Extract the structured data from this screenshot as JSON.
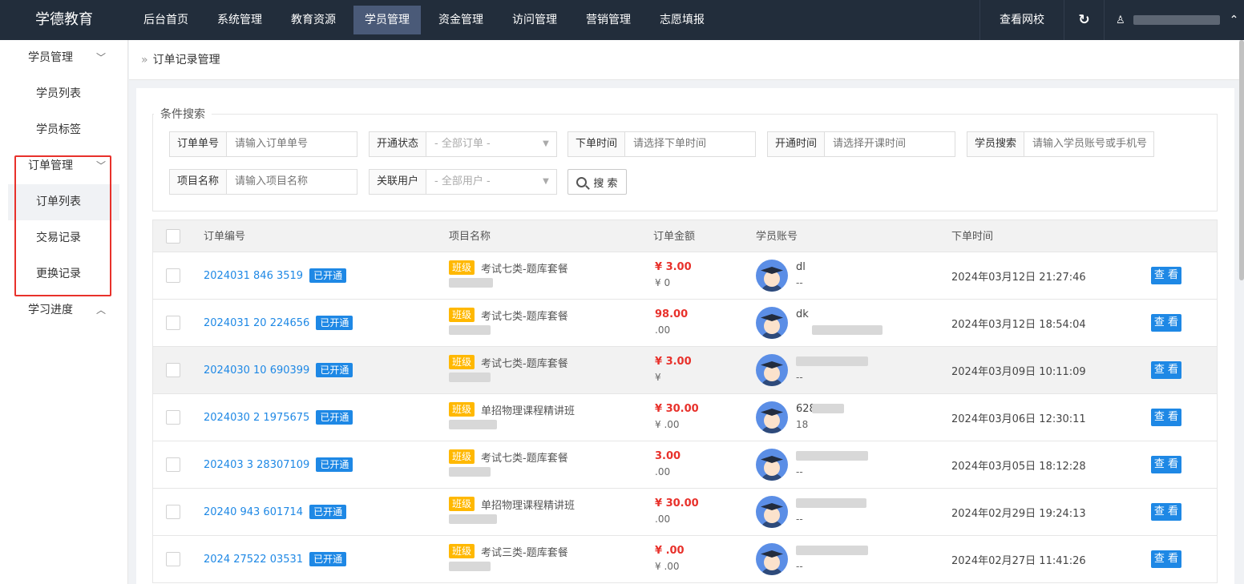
{
  "header": {
    "logo": "学德教育",
    "nav": [
      "后台首页",
      "系统管理",
      "教育资源",
      "学员管理",
      "资金管理",
      "访问管理",
      "营销管理",
      "志愿填报"
    ],
    "active_nav": "学员管理",
    "view_site": "查看网校",
    "refresh_icon": "↻",
    "user_icon": "♙",
    "caret": "⌃"
  },
  "sidebar": {
    "groups": [
      {
        "label": "学员管理",
        "chev": "﹀",
        "items": [
          "学员列表",
          "学员标签"
        ]
      },
      {
        "label": "订单管理",
        "chev": "﹀",
        "items": [
          "订单列表",
          "交易记录",
          "更换记录"
        ]
      },
      {
        "label": "学习进度",
        "chev": "︿",
        "items": []
      }
    ],
    "active_item": "订单列表"
  },
  "breadcrumb": {
    "sep": "»",
    "title": "订单记录管理"
  },
  "search": {
    "legend": "条件搜索",
    "order_no": {
      "label": "订单单号",
      "placeholder": "请输入订单单号"
    },
    "status": {
      "label": "开通状态",
      "value": "- 全部订单 -"
    },
    "order_time": {
      "label": "下单时间",
      "placeholder": "请选择下单时间"
    },
    "open_time": {
      "label": "开通时间",
      "placeholder": "请选择开课时间"
    },
    "student": {
      "label": "学员搜索",
      "placeholder": "请输入学员账号或手机号"
    },
    "project": {
      "label": "项目名称",
      "placeholder": "请输入项目名称"
    },
    "related_user": {
      "label": "关联用户",
      "value": "- 全部用户 -"
    },
    "search_button": "搜 索"
  },
  "table": {
    "headers": {
      "order_no": "订单编号",
      "project": "项目名称",
      "amount": "订单金额",
      "account": "学员账号",
      "time": "下单时间"
    },
    "status_label": "已开通",
    "tag_label": "班级",
    "view_label": "查 看",
    "rows": [
      {
        "order_no": "2024031  846  3519",
        "project": "考试七类-题库套餐",
        "price": "¥  3.00",
        "orig": "¥     0",
        "acc1": "dl",
        "acc2": "--",
        "time": "2024年03月12日 21:27:46"
      },
      {
        "order_no": "2024031  20  224656",
        "project": "考试七类-题库套餐",
        "price": " 98.00",
        "orig": "   .00",
        "acc1": "dk",
        "acc2": "",
        "time": "2024年03月12日 18:54:04"
      },
      {
        "order_no": "2024030  10  690399",
        "project": "考试七类-题库套餐",
        "price": "¥  3.00",
        "orig": "¥",
        "acc1": "",
        "acc2": "--",
        "time": "2024年03月09日 10:11:09"
      },
      {
        "order_no": "2024030  2 1975675",
        "project": "单招物理课程精讲班",
        "price": "¥  30.00",
        "orig": "¥ .00",
        "acc1": "  62809",
        "acc2": "18",
        "time": "2024年03月06日 12:30:11"
      },
      {
        "order_no": "202403  3 28307109",
        "project": "考试七类-题库套餐",
        "price": "  3.00",
        "orig": "  .00",
        "acc1": "",
        "acc2": "--",
        "time": "2024年03月05日 18:12:28"
      },
      {
        "order_no": "20240  943  601714",
        "project": "单招物理课程精讲班",
        "price": "¥  30.00",
        "orig": "  .00",
        "acc1": "",
        "acc2": "--",
        "time": "2024年02月29日 19:24:13"
      },
      {
        "order_no": "2024 27522  03531",
        "project": "考试三类-题库套餐",
        "price": "¥   .00",
        "orig": "¥  .00",
        "acc1": "",
        "acc2": "--",
        "time": "2024年02月27日 11:41:26"
      }
    ]
  }
}
